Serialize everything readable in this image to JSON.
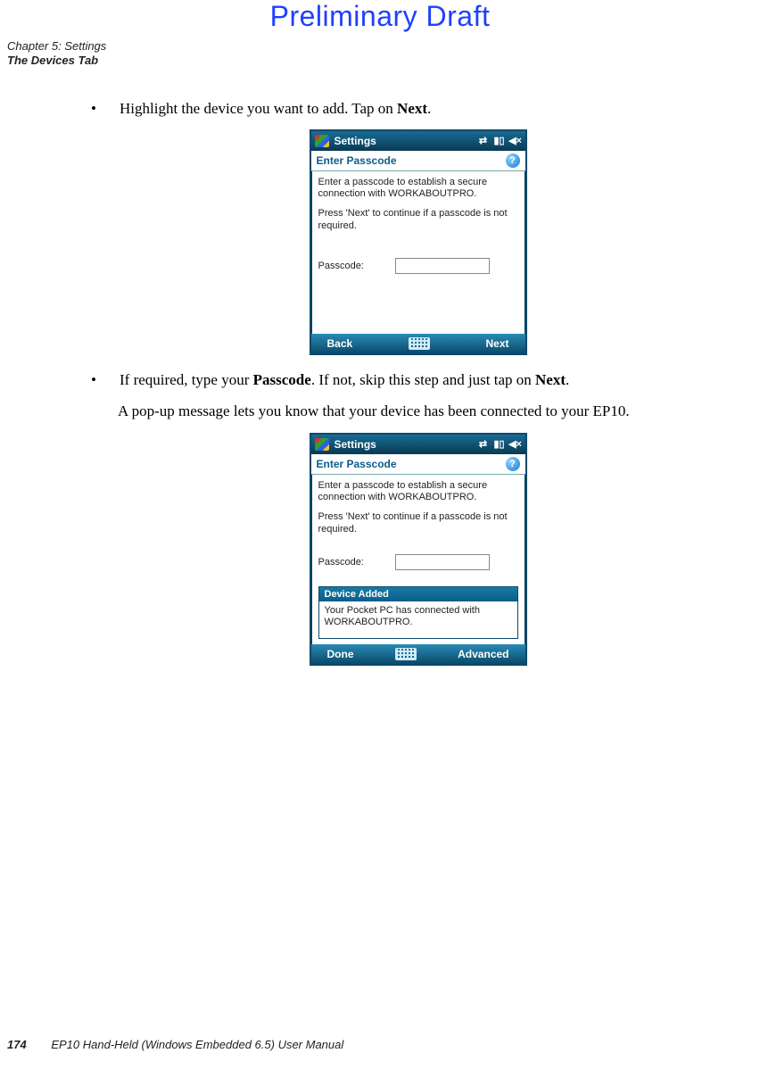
{
  "watermark": "Preliminary Draft",
  "header": {
    "chapter": "Chapter 5: Settings",
    "section": "The Devices Tab"
  },
  "body": {
    "bullet1_pre": "Highlight the device you want to add. Tap on ",
    "bullet1_bold": "Next",
    "bullet1_post": ".",
    "bullet2_pre": "If required, type your ",
    "bullet2_bold1": "Passcode",
    "bullet2_mid": ". If not, skip this step and just tap on ",
    "bullet2_bold2": "Next",
    "bullet2_post": ".",
    "after_bullet2": "A pop-up message lets you know that your device has been connected to your EP10."
  },
  "screenshot1": {
    "title": "Settings",
    "subhead": "Enter Passcode",
    "help": "?",
    "line1": "Enter a passcode to establish a secure connection with WORKABOUTPRO.",
    "line2": "Press 'Next' to continue if a passcode is not required.",
    "passcode_label": "Passcode:",
    "passcode_value": "",
    "left_soft": "Back",
    "right_soft": "Next"
  },
  "screenshot2": {
    "title": "Settings",
    "subhead": "Enter Passcode",
    "help": "?",
    "line1": "Enter a passcode to establish a secure connection with WORKABOUTPRO.",
    "line2": "Press 'Next' to continue if a passcode is not required.",
    "passcode_label": "Passcode:",
    "passcode_value": "",
    "popup_title": "Device Added",
    "popup_body": "Your Pocket PC has connected with WORKABOUTPRO.",
    "left_soft": "Done",
    "right_soft": "Advanced"
  },
  "footer": {
    "page": "174",
    "title": "EP10 Hand-Held (Windows Embedded 6.5) User Manual"
  }
}
